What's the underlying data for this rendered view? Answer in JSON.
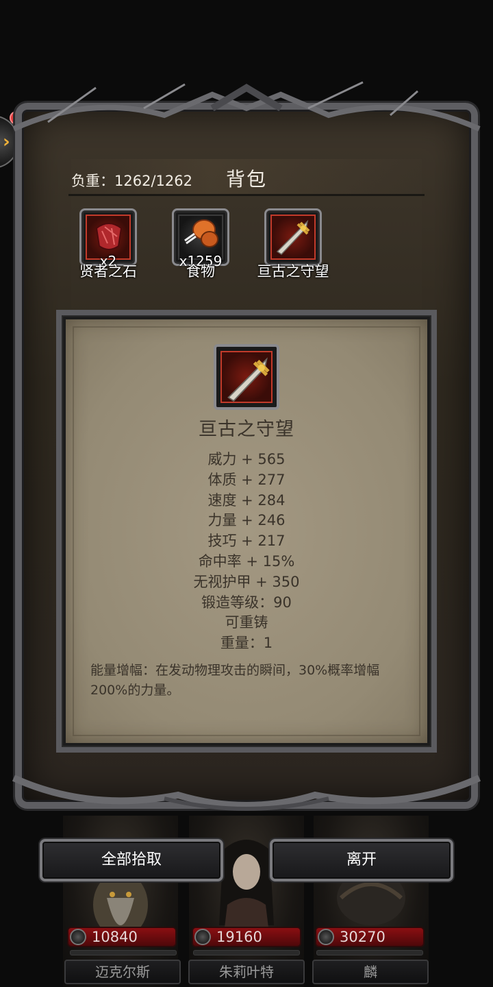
{
  "notification_dot": true,
  "bag": {
    "weight_label": "负重：1262/1262",
    "title": "背包"
  },
  "inventory": [
    {
      "name": "贤者之石",
      "count": "x2",
      "icon": "red-gem-icon"
    },
    {
      "name": "食物",
      "count": "x1259",
      "icon": "roast-meat-icon"
    },
    {
      "name": "亘古之守望",
      "count": "",
      "icon": "sword-icon"
    }
  ],
  "detail": {
    "icon": "sword-icon",
    "name": "亘古之守望",
    "stats": [
      "威力 + 565",
      "体质 + 277",
      "速度 + 284",
      "力量 + 246",
      "技巧 + 217",
      "命中率 + 15%",
      "无视护甲 + 350",
      "锻造等级：90",
      "可重铸",
      "重量：1"
    ],
    "description": "能量增幅：在发动物理攻击的瞬间，30%概率增幅200%的力量。"
  },
  "buttons": {
    "pickup_all": "全部拾取",
    "leave": "离开"
  },
  "party": [
    {
      "name": "迈克尔斯",
      "hp": "10840"
    },
    {
      "name": "朱莉叶特",
      "hp": "19160"
    },
    {
      "name": "麟",
      "hp": "30270"
    }
  ],
  "colors": {
    "accent_gold": "#f0b23a",
    "slot_border_red": "#c23a2a",
    "hp_red": "#8a0f12",
    "notification_red": "#e23b3b"
  }
}
